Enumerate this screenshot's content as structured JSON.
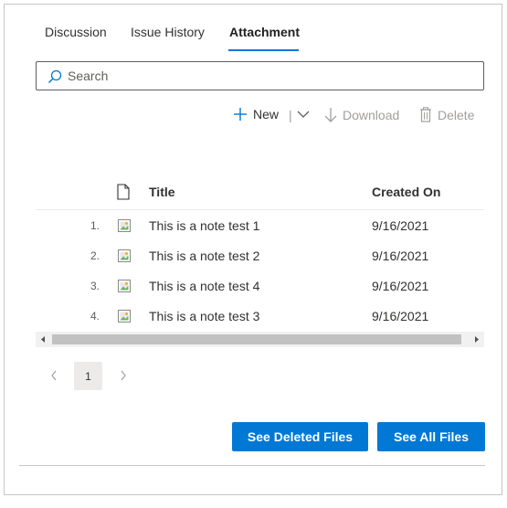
{
  "tabs": [
    {
      "label": "Discussion"
    },
    {
      "label": "Issue History"
    },
    {
      "label": "Attachment",
      "active": true
    }
  ],
  "search": {
    "placeholder": "Search",
    "icon": "search-icon"
  },
  "toolbar": {
    "new_label": "New",
    "download_label": "Download",
    "delete_label": "Delete"
  },
  "grid": {
    "columns": {
      "title": "Title",
      "created_on": "Created On"
    },
    "rows": [
      {
        "num": "1.",
        "title": "This is a note test 1",
        "created_on": "9/16/2021"
      },
      {
        "num": "2.",
        "title": "This is a note test 2",
        "created_on": "9/16/2021"
      },
      {
        "num": "3.",
        "title": "This is a note test 4",
        "created_on": "9/16/2021"
      },
      {
        "num": "4.",
        "title": "This is a note test 3",
        "created_on": "9/16/2021"
      }
    ]
  },
  "pager": {
    "current_page": "1"
  },
  "buttons": {
    "see_deleted": "See Deleted Files",
    "see_all": "See All Files"
  },
  "colors": {
    "accent": "#0078d4",
    "disabled": "#a19f9d"
  }
}
